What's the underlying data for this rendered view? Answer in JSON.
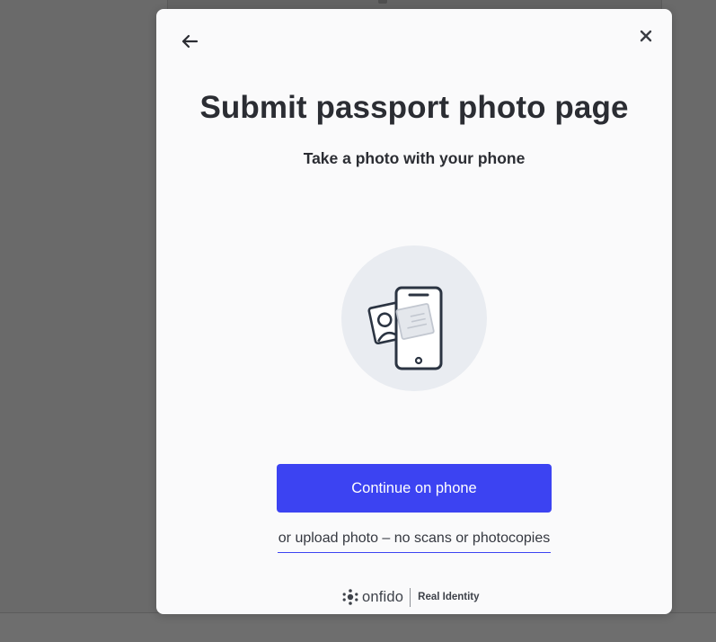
{
  "modal": {
    "title": "Submit passport photo page",
    "subtitle": "Take a photo with your phone",
    "back_icon": "arrow-left-icon",
    "close_icon": "close-icon",
    "primary_button_label": "Continue on phone",
    "upload_link_label": "or upload photo – no scans or photocopies",
    "illustration_icon": "phone-with-id-card-icon"
  },
  "footer": {
    "brand": "onfido",
    "tagline": "Real Identity"
  },
  "colors": {
    "primary": "#3c43f2",
    "text": "#2b2d33",
    "overlay": "#6a6a6a",
    "modal_bg": "#fafafb",
    "illustration_circle": "#e9ecf1",
    "illustration_stroke": "#2b3442"
  }
}
